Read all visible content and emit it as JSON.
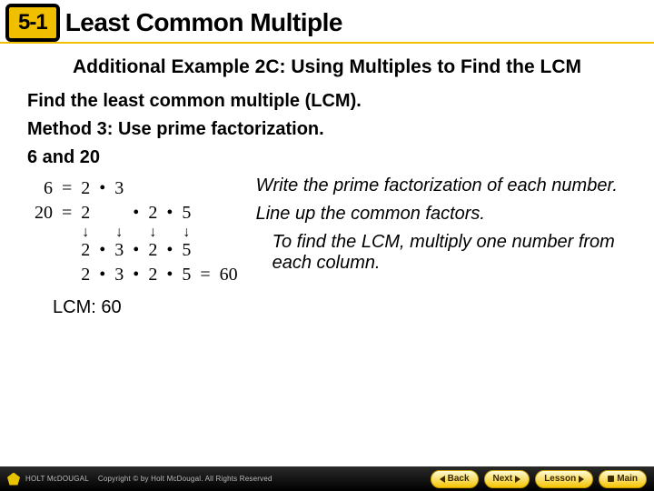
{
  "header": {
    "badge": "5-1",
    "title": "Least Common Multiple"
  },
  "content": {
    "subhead": "Additional Example 2C: Using Multiples to Find the LCM",
    "instruction": "Find the least common multiple (LCM).",
    "method": "Method 3: Use prime factorization.",
    "pair": "6 and 20",
    "table": {
      "r1": {
        "n": "6",
        "eq": "=",
        "c1": "2",
        "d1": "•",
        "c2": "3",
        "d2": "",
        "c3": "",
        "d3": "",
        "c4": ""
      },
      "r2": {
        "n": "20",
        "eq": "=",
        "c1": "2",
        "d1": "",
        "c2": "",
        "d2": "•",
        "c3": "2",
        "d3": "•",
        "c4": "5"
      },
      "arrows": {
        "a1": "↓",
        "a2": "↓",
        "a3": "↓",
        "a4": "↓"
      },
      "r3": {
        "n": "",
        "eq": "",
        "c1": "2",
        "d1": "•",
        "c2": "3",
        "d2": "•",
        "c3": "2",
        "d3": "•",
        "c4": "5"
      },
      "r4": {
        "n": "",
        "eq": "",
        "c1": "2",
        "d1": "•",
        "c2": "3",
        "d2": "•",
        "c3": "2",
        "d3": "•",
        "c4": "5",
        "res_eq": "=",
        "res": "60"
      }
    },
    "explain": {
      "e1": "Write the prime factorization of each number.",
      "e2": "Line up the common factors.",
      "e3": "To find the LCM, multiply one number from each column."
    },
    "lcm": "LCM: 60"
  },
  "footer": {
    "brand1": "HOLT McDOUGAL",
    "brand2": "Copyright © by Holt McDougal. All Rights Reserved",
    "nav": {
      "back": "Back",
      "next": "Next",
      "lesson": "Lesson",
      "main": "Main"
    }
  }
}
